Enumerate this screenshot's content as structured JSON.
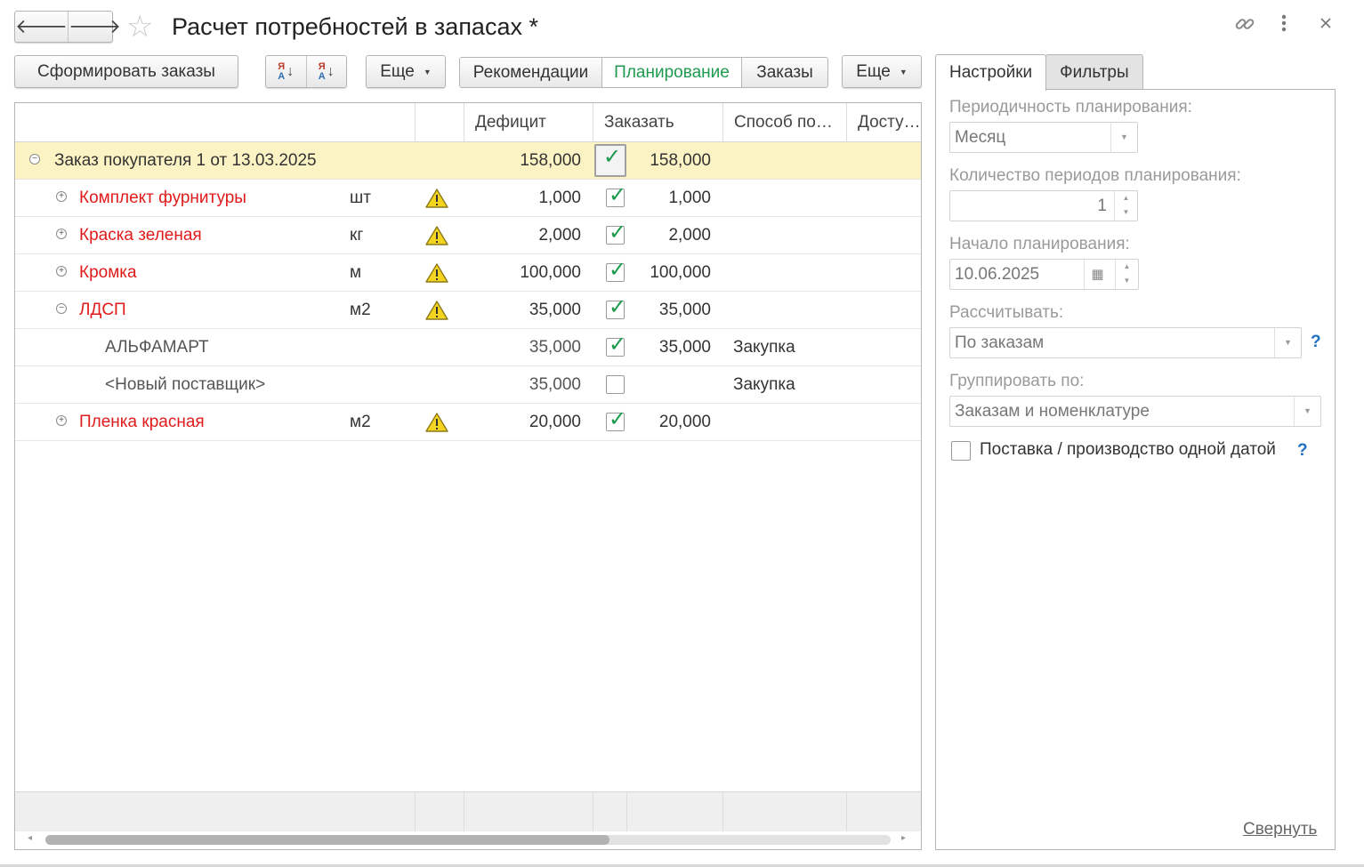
{
  "window": {
    "title": "Расчет потребностей в запасах *",
    "back_label": "🡐",
    "forward_label": "🡒"
  },
  "toolbar": {
    "create_orders_label": "Сформировать заказы",
    "more1_label": "Еще",
    "views": [
      "Рекомендации",
      "Планирование",
      "Заказы"
    ],
    "active_view": "Планирование",
    "more2_label": "Еще"
  },
  "grid": {
    "columns": [
      "",
      "",
      "Дефицит",
      "Заказать",
      "Способ по…",
      "Досту…"
    ],
    "rows": [
      {
        "name": "Заказ покупателя 1 от 13.03.2025",
        "unit": "",
        "warning": false,
        "deficit": "158,000",
        "checked": true,
        "order": "158,000",
        "method": "",
        "toggle": "⊖"
      },
      {
        "name": "Комплект фурнитуры",
        "unit": "шт",
        "warning": true,
        "deficit": "1,000",
        "checked": true,
        "order": "1,000",
        "method": "",
        "toggle": "⊕"
      },
      {
        "name": "Краска зеленая",
        "unit": "кг",
        "warning": true,
        "deficit": "2,000",
        "checked": true,
        "order": "2,000",
        "method": "",
        "toggle": "⊕"
      },
      {
        "name": "Кромка",
        "unit": "м",
        "warning": true,
        "deficit": "100,000",
        "checked": true,
        "order": "100,000",
        "method": "",
        "toggle": "⊕"
      },
      {
        "name": "ЛДСП",
        "unit": "м2",
        "warning": true,
        "deficit": "35,000",
        "checked": true,
        "order": "35,000",
        "method": "",
        "toggle": "⊖"
      },
      {
        "name": "АЛЬФАМАРТ",
        "unit": "",
        "warning": false,
        "deficit": "35,000",
        "checked": true,
        "order": "35,000",
        "method": "Закупка",
        "toggle": ""
      },
      {
        "name": "<Новый поставщик>",
        "unit": "",
        "warning": false,
        "deficit": "35,000",
        "checked": false,
        "order": "",
        "method": "Закупка",
        "toggle": ""
      },
      {
        "name": "Пленка красная",
        "unit": "м2",
        "warning": true,
        "deficit": "20,000",
        "checked": true,
        "order": "20,000",
        "method": "",
        "toggle": "⊕"
      }
    ]
  },
  "settings": {
    "tabs": [
      "Настройки",
      "Фильтры"
    ],
    "active_tab": "Настройки",
    "periodicity_label": "Периодичность планирования:",
    "periodicity_value": "Месяц",
    "periods_count_label": "Количество периодов планирования:",
    "periods_count_value": "1",
    "start_label": "Начало планирования:",
    "start_value": "10.06.2025",
    "calculate_label": "Рассчитывать:",
    "calculate_value": "По заказам",
    "group_label": "Группировать по:",
    "group_value": "Заказам и номенклатуре",
    "single_date_label": "Поставка / производство одной датой",
    "single_date_checked": false,
    "help_mark": "?",
    "collapse_label": "Свернуть"
  },
  "colors": {
    "accent_green": "#1e9a4e",
    "error_red": "#e01b1b",
    "selected_row": "#fcf3c4",
    "help_blue": "#1f6fc5"
  }
}
